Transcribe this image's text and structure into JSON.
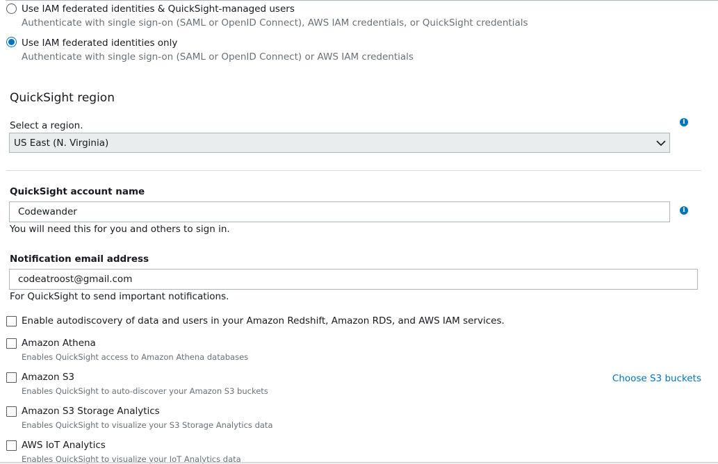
{
  "identity_options": [
    {
      "label": "Use IAM federated identities & QuickSight-managed users",
      "description": "Authenticate with single sign-on (SAML or OpenID Connect), AWS IAM credentials, or QuickSight credentials",
      "selected": false
    },
    {
      "label": "Use IAM federated identities only",
      "description": "Authenticate with single sign-on (SAML or OpenID Connect) or AWS IAM credentials",
      "selected": true
    }
  ],
  "region": {
    "heading": "QuickSight region",
    "select_label": "Select a region.",
    "selected_value": "US East (N. Virginia)"
  },
  "account": {
    "title": "QuickSight account name",
    "value": "Codewander",
    "help": "You will need this for you and others to sign in."
  },
  "email": {
    "title": "Notification email address",
    "value": "codeatroost@gmail.com",
    "help": "For QuickSight to send important notifications."
  },
  "autodiscovery": {
    "label": "Enable autodiscovery of data and users in your Amazon Redshift, Amazon RDS, and AWS IAM services.",
    "checked": false
  },
  "services": [
    {
      "label": "Amazon Athena",
      "description": "Enables QuickSight access to Amazon Athena databases",
      "checked": false
    },
    {
      "label": "Amazon S3",
      "description": "Enables QuickSight to auto-discover your Amazon S3 buckets",
      "checked": false
    },
    {
      "label": "Amazon S3 Storage Analytics",
      "description": "Enables QuickSight to visualize your S3 Storage Analytics data",
      "checked": false
    },
    {
      "label": "AWS IoT Analytics",
      "description": "Enables QuickSight to visualize your IoT Analytics data",
      "checked": false
    }
  ],
  "s3_link": "Choose S3 buckets",
  "colors": {
    "accent": "#0073bb",
    "text": "#16191f",
    "muted": "#687078",
    "border": "#aab7b8"
  }
}
